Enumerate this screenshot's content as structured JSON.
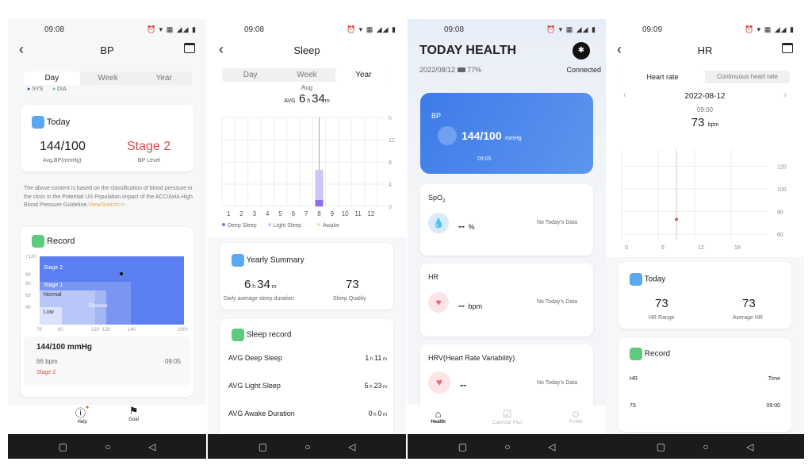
{
  "status": {
    "bp_time": "09:08",
    "sleep_time": "09:08",
    "health_time": "09:08",
    "hr_time": "09:09"
  },
  "bp": {
    "title": "BP",
    "tabs": [
      "Day",
      "Week",
      "Year"
    ],
    "legend": [
      "SYS",
      "DIA"
    ],
    "today": {
      "label": "Today",
      "value": "144/100",
      "value_label": "Avg.BP(mmHg)",
      "level": "Stage 2",
      "level_label": "BP Level"
    },
    "note": "The above content is based on the classification of blood pressure in the clinic in the Potential US Population impact of the ACC/AHA High Blood Pressure Guideline.",
    "note_link": "View/Switch>>",
    "record": {
      "label": "Record",
      "zones": [
        "Stage 2",
        "Stage 1",
        "Normal",
        "Elevated",
        "Low"
      ],
      "y_ticks": [
        "+120",
        "90",
        "80",
        "60",
        "40"
      ],
      "x_ticks": [
        "70",
        "90",
        "120",
        "130",
        "140",
        "200+"
      ],
      "point": {
        "sys": 144,
        "dia": 100
      },
      "reading": "144/100 mmHg",
      "bpm": "66 bpm",
      "time": "09:05",
      "stage": "Stage 2"
    },
    "nav": [
      "Help",
      "Goal"
    ]
  },
  "sleep": {
    "title": "Sleep",
    "tabs": [
      "Day",
      "Week",
      "Year"
    ],
    "month": "Aug",
    "avg_label": "AVG",
    "avg_h": "6",
    "avg_m": "34",
    "h": "h",
    "m": "m",
    "chart_data": {
      "type": "bar",
      "categories": [
        "1",
        "2",
        "3",
        "4",
        "5",
        "6",
        "7",
        "8",
        "9",
        "10",
        "11",
        "12"
      ],
      "y_ticks": [
        "h",
        "12",
        "8",
        "4",
        "0"
      ],
      "ylim": [
        0,
        16
      ],
      "series": [
        {
          "name": "Deep Sleep",
          "values": [
            0,
            0,
            0,
            0,
            0,
            0,
            0,
            1.18,
            0,
            0,
            0,
            0
          ],
          "color": "#8b6cf0"
        },
        {
          "name": "Light Sleep",
          "values": [
            0,
            0,
            0,
            0,
            0,
            0,
            0,
            5.38,
            0,
            0,
            0,
            0
          ],
          "color": "#cfc4f7"
        },
        {
          "name": "Awake",
          "values": [
            0,
            0,
            0,
            0,
            0,
            0,
            0,
            0,
            0,
            0,
            0,
            0
          ],
          "color": "#f5e6b5"
        }
      ]
    },
    "summary": {
      "label": "Yearly Summary",
      "dur_h": "6",
      "dur_m": "34",
      "dur_label": "Daily average sleep duration",
      "quality": "73",
      "quality_label": "Sleep Quality"
    },
    "record": {
      "label": "Sleep record",
      "rows": [
        {
          "label": "AVG Deep Sleep",
          "h": "1",
          "m": "11"
        },
        {
          "label": "AVG Light Sleep",
          "h": "5",
          "m": "23"
        },
        {
          "label": "AVG Awake Duration",
          "h": "0",
          "m": "0"
        }
      ]
    }
  },
  "health": {
    "title": "TODAY HEALTH",
    "date": "2022/08/12",
    "battery": "77%",
    "connection": "Connected",
    "bp": {
      "label": "BP",
      "value": "144/100",
      "unit": "mmHg",
      "time": "09:05"
    },
    "spo2": {
      "label": "SpO",
      "sub": "2",
      "value": "--",
      "unit": "%",
      "nodata": "No Today's Data"
    },
    "hr": {
      "label": "HR",
      "value": "--",
      "unit": "bpm",
      "nodata": "No Today's Data"
    },
    "hrv": {
      "label": "HRV(Heart Rate Variability)",
      "value": "--",
      "nodata": "No Today's Data"
    },
    "nav": [
      "Health",
      "Calendar Plan",
      "Profile"
    ]
  },
  "hr": {
    "title": "HR",
    "tabs": [
      "Heart rate",
      "Continuous heart rate"
    ],
    "date": "2022-08-12",
    "sel_time": "09:00",
    "sel_value": "73",
    "unit": "bpm",
    "chart_data": {
      "type": "scatter",
      "x_ticks": [
        "0",
        "6",
        "12",
        "18"
      ],
      "y_ticks": [
        "120",
        "100",
        "80",
        "60"
      ],
      "points": [
        {
          "x": 9,
          "y": 73
        }
      ],
      "color": "#e05a5a"
    },
    "today": {
      "label": "Today",
      "range": "73",
      "range_label": "HR Range",
      "avg": "73",
      "avg_label": "Average HR"
    },
    "record": {
      "label": "Record",
      "col1": "HR",
      "col2": "Time",
      "rows": [
        {
          "hr": "73",
          "time": "09:00"
        }
      ]
    }
  }
}
